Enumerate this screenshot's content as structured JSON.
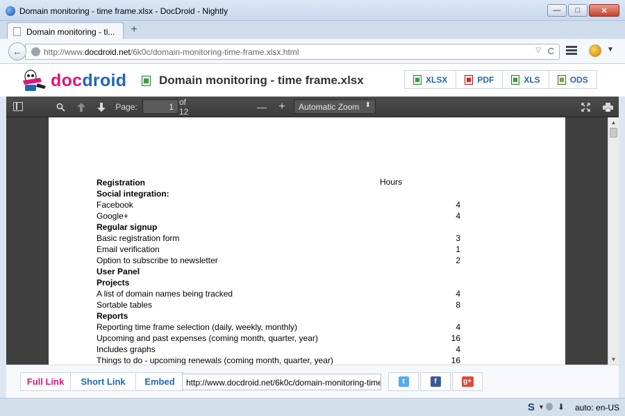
{
  "window": {
    "title": "Domain monitoring - time frame.xlsx - DocDroid - Nightly",
    "minimize": "—",
    "maximize": "□",
    "close": "✕"
  },
  "tabs": [
    {
      "label": "Domain monitoring - ti..."
    }
  ],
  "newtab_glyph": "+",
  "nav": {
    "url_prefix": "http://www.",
    "url_domain": "docdroid.net",
    "url_rest": "/6k0c/domain-monitoring-time-frame.xlsx.html",
    "back_glyph": "←",
    "dropdown_glyph": "▽",
    "reload_glyph": "C"
  },
  "header": {
    "logo_part1": "doc",
    "logo_part2": "droid",
    "doc_title": "Domain monitoring - time frame.xlsx",
    "downloads": [
      {
        "label": "XLSX",
        "icon": "spreadsheet-icon"
      },
      {
        "label": "PDF",
        "icon": "pdf-icon"
      },
      {
        "label": "XLS",
        "icon": "spreadsheet-icon"
      },
      {
        "label": "ODS",
        "icon": "ods-icon"
      }
    ]
  },
  "pdf_toolbar": {
    "page_label": "Page:",
    "page_value": "1",
    "page_total": "of 12",
    "zoom_out": "—",
    "zoom_in": "+",
    "zoom_value": "Automatic Zoom",
    "zoom_arrow": "⬍"
  },
  "document": {
    "hours_header": "Hours",
    "rows": [
      {
        "label": "Registration",
        "value": "",
        "heading": true
      },
      {
        "label": "Social integration:",
        "value": "",
        "heading": true
      },
      {
        "label": "Facebook",
        "value": "4",
        "heading": false
      },
      {
        "label": "Google+",
        "value": "4",
        "heading": false
      },
      {
        "label": "Regular signup",
        "value": "",
        "heading": true
      },
      {
        "label": "Basic registration form",
        "value": "3",
        "heading": false
      },
      {
        "label": "Email verification",
        "value": "1",
        "heading": false
      },
      {
        "label": "Option to subscribe to newsletter",
        "value": "2",
        "heading": false
      },
      {
        "label": "User Panel",
        "value": "",
        "heading": true
      },
      {
        "label": "Projects",
        "value": "",
        "heading": true
      },
      {
        "label": "A list of domain names being tracked",
        "value": "4",
        "heading": false
      },
      {
        "label": "Sortable tables",
        "value": "8",
        "heading": false
      },
      {
        "label": "Reports",
        "value": "",
        "heading": true
      },
      {
        "label": "Reporting time frame selection (daily, weekly, monthly)",
        "value": "4",
        "heading": false
      },
      {
        "label": "Upcoming and past expenses (coming month, quarter, year)",
        "value": "16",
        "heading": false
      },
      {
        "label": "Includes graphs",
        "value": "4",
        "heading": false
      },
      {
        "label": "Things to do - upcoming renewals (coming month, quarter, year)",
        "value": "16",
        "heading": false
      }
    ]
  },
  "share": {
    "full_link": "Full Link",
    "short_link": "Short Link",
    "embed": "Embed",
    "link_value": "http://www.docdroid.net/6k0c/domain-monitoring-time",
    "social": [
      {
        "name": "twitter",
        "glyph": "t",
        "color": "#55acee"
      },
      {
        "name": "facebook",
        "glyph": "f",
        "color": "#3b5998"
      },
      {
        "name": "google-plus",
        "glyph": "g+",
        "color": "#dd4b39"
      }
    ]
  },
  "status": {
    "spell_glyph": "S",
    "locale": "auto: en-US"
  }
}
